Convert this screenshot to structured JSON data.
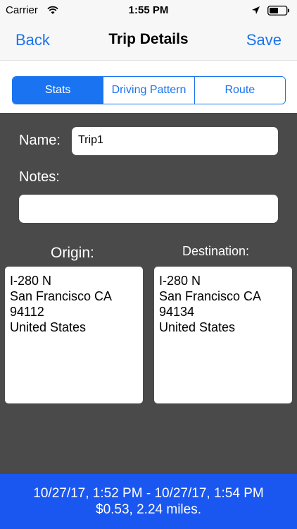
{
  "status": {
    "carrier": "Carrier",
    "time": "1:55 PM"
  },
  "nav": {
    "back_label": "Back",
    "title": "Trip Details",
    "save_label": "Save"
  },
  "tabs": [
    {
      "label": "Stats",
      "active": true
    },
    {
      "label": "Driving Pattern",
      "active": false
    },
    {
      "label": "Route",
      "active": false
    }
  ],
  "form": {
    "name_label": "Name:",
    "name_value": "Trip1",
    "notes_label": "Notes:",
    "notes_value": ""
  },
  "origin": {
    "label": "Origin:",
    "lines": [
      "I-280 N",
      "San Francisco CA",
      "94112",
      "United States"
    ]
  },
  "destination": {
    "label": "Destination:",
    "lines": [
      "I-280 N",
      "San Francisco CA",
      "94134",
      "United States"
    ]
  },
  "summary": {
    "time_range": "10/27/17, 1:52 PM - 10/27/17, 1:54 PM",
    "cost_distance": "$0.53, 2.24 miles."
  },
  "colors": {
    "accent": "#1a73f0",
    "footer": "#1a56f0",
    "background": "#4a4a4a"
  },
  "icons": [
    "wifi-icon",
    "location-arrow-icon",
    "battery-icon"
  ]
}
